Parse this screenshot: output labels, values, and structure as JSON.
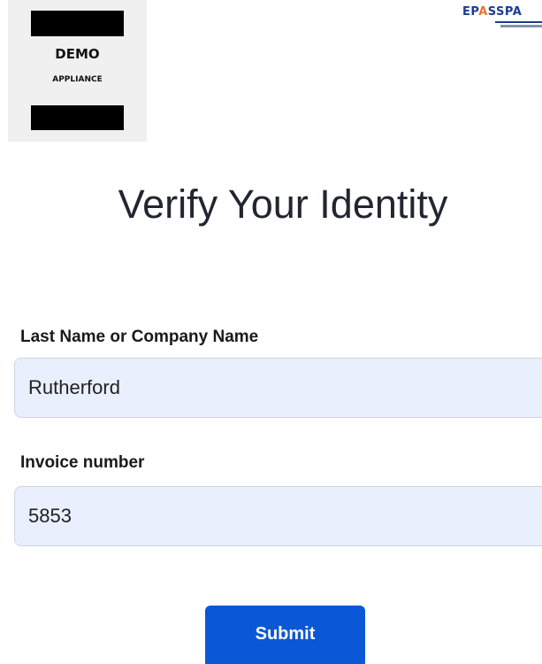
{
  "logo": {
    "line1": "DEMO",
    "line2": "APPLIANCE",
    "brand_prefix": "EP",
    "brand_accent": "A",
    "brand_suffix": "SSPA"
  },
  "page": {
    "title": "Verify Your Identity"
  },
  "form": {
    "name_label": "Last Name or Company Name",
    "name_value": "Rutherford",
    "invoice_label": "Invoice number",
    "invoice_value": "5853",
    "submit_label": "Submit"
  },
  "colors": {
    "input_background": "#e9effd",
    "button_background": "#0a58d6",
    "brand_blue": "#1b3c8f",
    "brand_orange": "#e8742a"
  }
}
